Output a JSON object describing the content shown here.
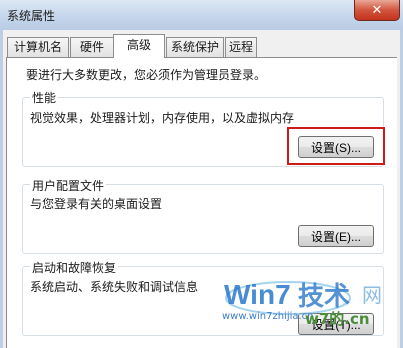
{
  "window": {
    "title": "系统属性",
    "close_symbol": "✕"
  },
  "tabs": [
    {
      "label": "计算机名",
      "active": false
    },
    {
      "label": "硬件",
      "active": false
    },
    {
      "label": "高级",
      "active": true
    },
    {
      "label": "系统保护",
      "active": false
    },
    {
      "label": "远程",
      "active": false
    }
  ],
  "admin_note": "要进行大多数更改，您必须作为管理员登录。",
  "performance": {
    "title": "性能",
    "description": "视觉效果，处理器计划，内存使用，以及虚拟内存",
    "settings_button": "设置(S)..."
  },
  "user_profiles": {
    "title": "用户配置文件",
    "description": "与您登录有关的桌面设置",
    "settings_button": "设置(E)..."
  },
  "startup_recovery": {
    "title": "启动和故障恢复",
    "description": "系统启动、系统失败和调试信息",
    "settings_button": "设置(T)..."
  },
  "watermark": {
    "logo_text": "Win7",
    "logo_text_cn": "技术",
    "logo_suffix": "网",
    "url": "www.win7zhijia.cn",
    "brand": "w7的.cn"
  },
  "colors": {
    "highlight": "#cc1b1b",
    "titlebar": "#c3d4ea",
    "close_button": "#d2553f"
  }
}
